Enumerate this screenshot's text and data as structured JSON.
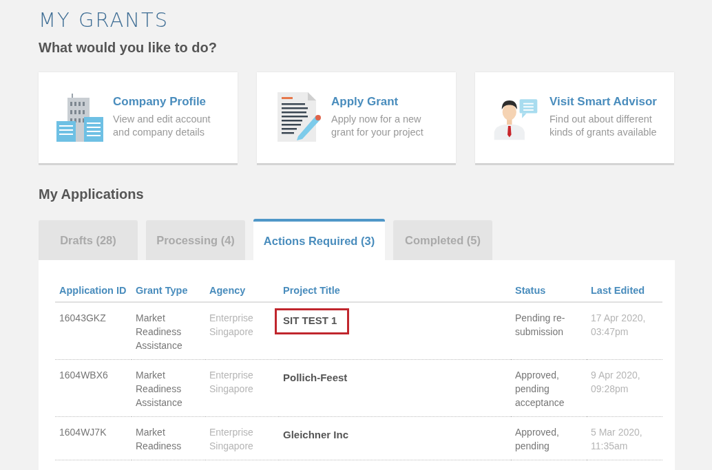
{
  "page_title": "MY GRANTS",
  "prompt": "What would you like to do?",
  "actions": [
    {
      "kind": "building",
      "title": "Company Profile",
      "description": "View and edit account and company details"
    },
    {
      "kind": "document",
      "title": "Apply Grant",
      "description": "Apply now for a new grant for your project"
    },
    {
      "kind": "advisor",
      "title": "Visit Smart Advisor",
      "description": "Find out about different kinds of grants available"
    }
  ],
  "applications": {
    "heading": "My Applications",
    "tabs": [
      {
        "label": "Drafts (28)",
        "selected": false
      },
      {
        "label": "Processing (4)",
        "selected": false
      },
      {
        "label": "Actions Required (3)",
        "selected": true
      },
      {
        "label": "Completed (5)",
        "selected": false
      }
    ],
    "table": {
      "columns": [
        "Application ID",
        "Grant Type",
        "Agency",
        "Project Title",
        "Status",
        "Last Edited"
      ],
      "rows": [
        {
          "cells": [
            "16043GKZ",
            "Market Readiness Assistance",
            "Enterprise Singapore",
            "SIT TEST 1",
            "Pending re-submission",
            "17 Apr 2020, 03:47pm"
          ],
          "highlighted": true
        },
        {
          "cells": [
            "1604WBX6",
            "Market Readiness Assistance",
            "Enterprise Singapore",
            "Pollich-Feest",
            "Approved, pending acceptance",
            "9 Apr 2020, 09:28pm"
          ],
          "highlighted": false
        },
        {
          "cells": [
            "1604WJ7K",
            "Market Readiness",
            "Enterprise Singapore",
            "Gleichner Inc",
            "Approved, pending",
            "5 Mar 2020, 11:35am"
          ],
          "highlighted": false
        }
      ]
    }
  }
}
